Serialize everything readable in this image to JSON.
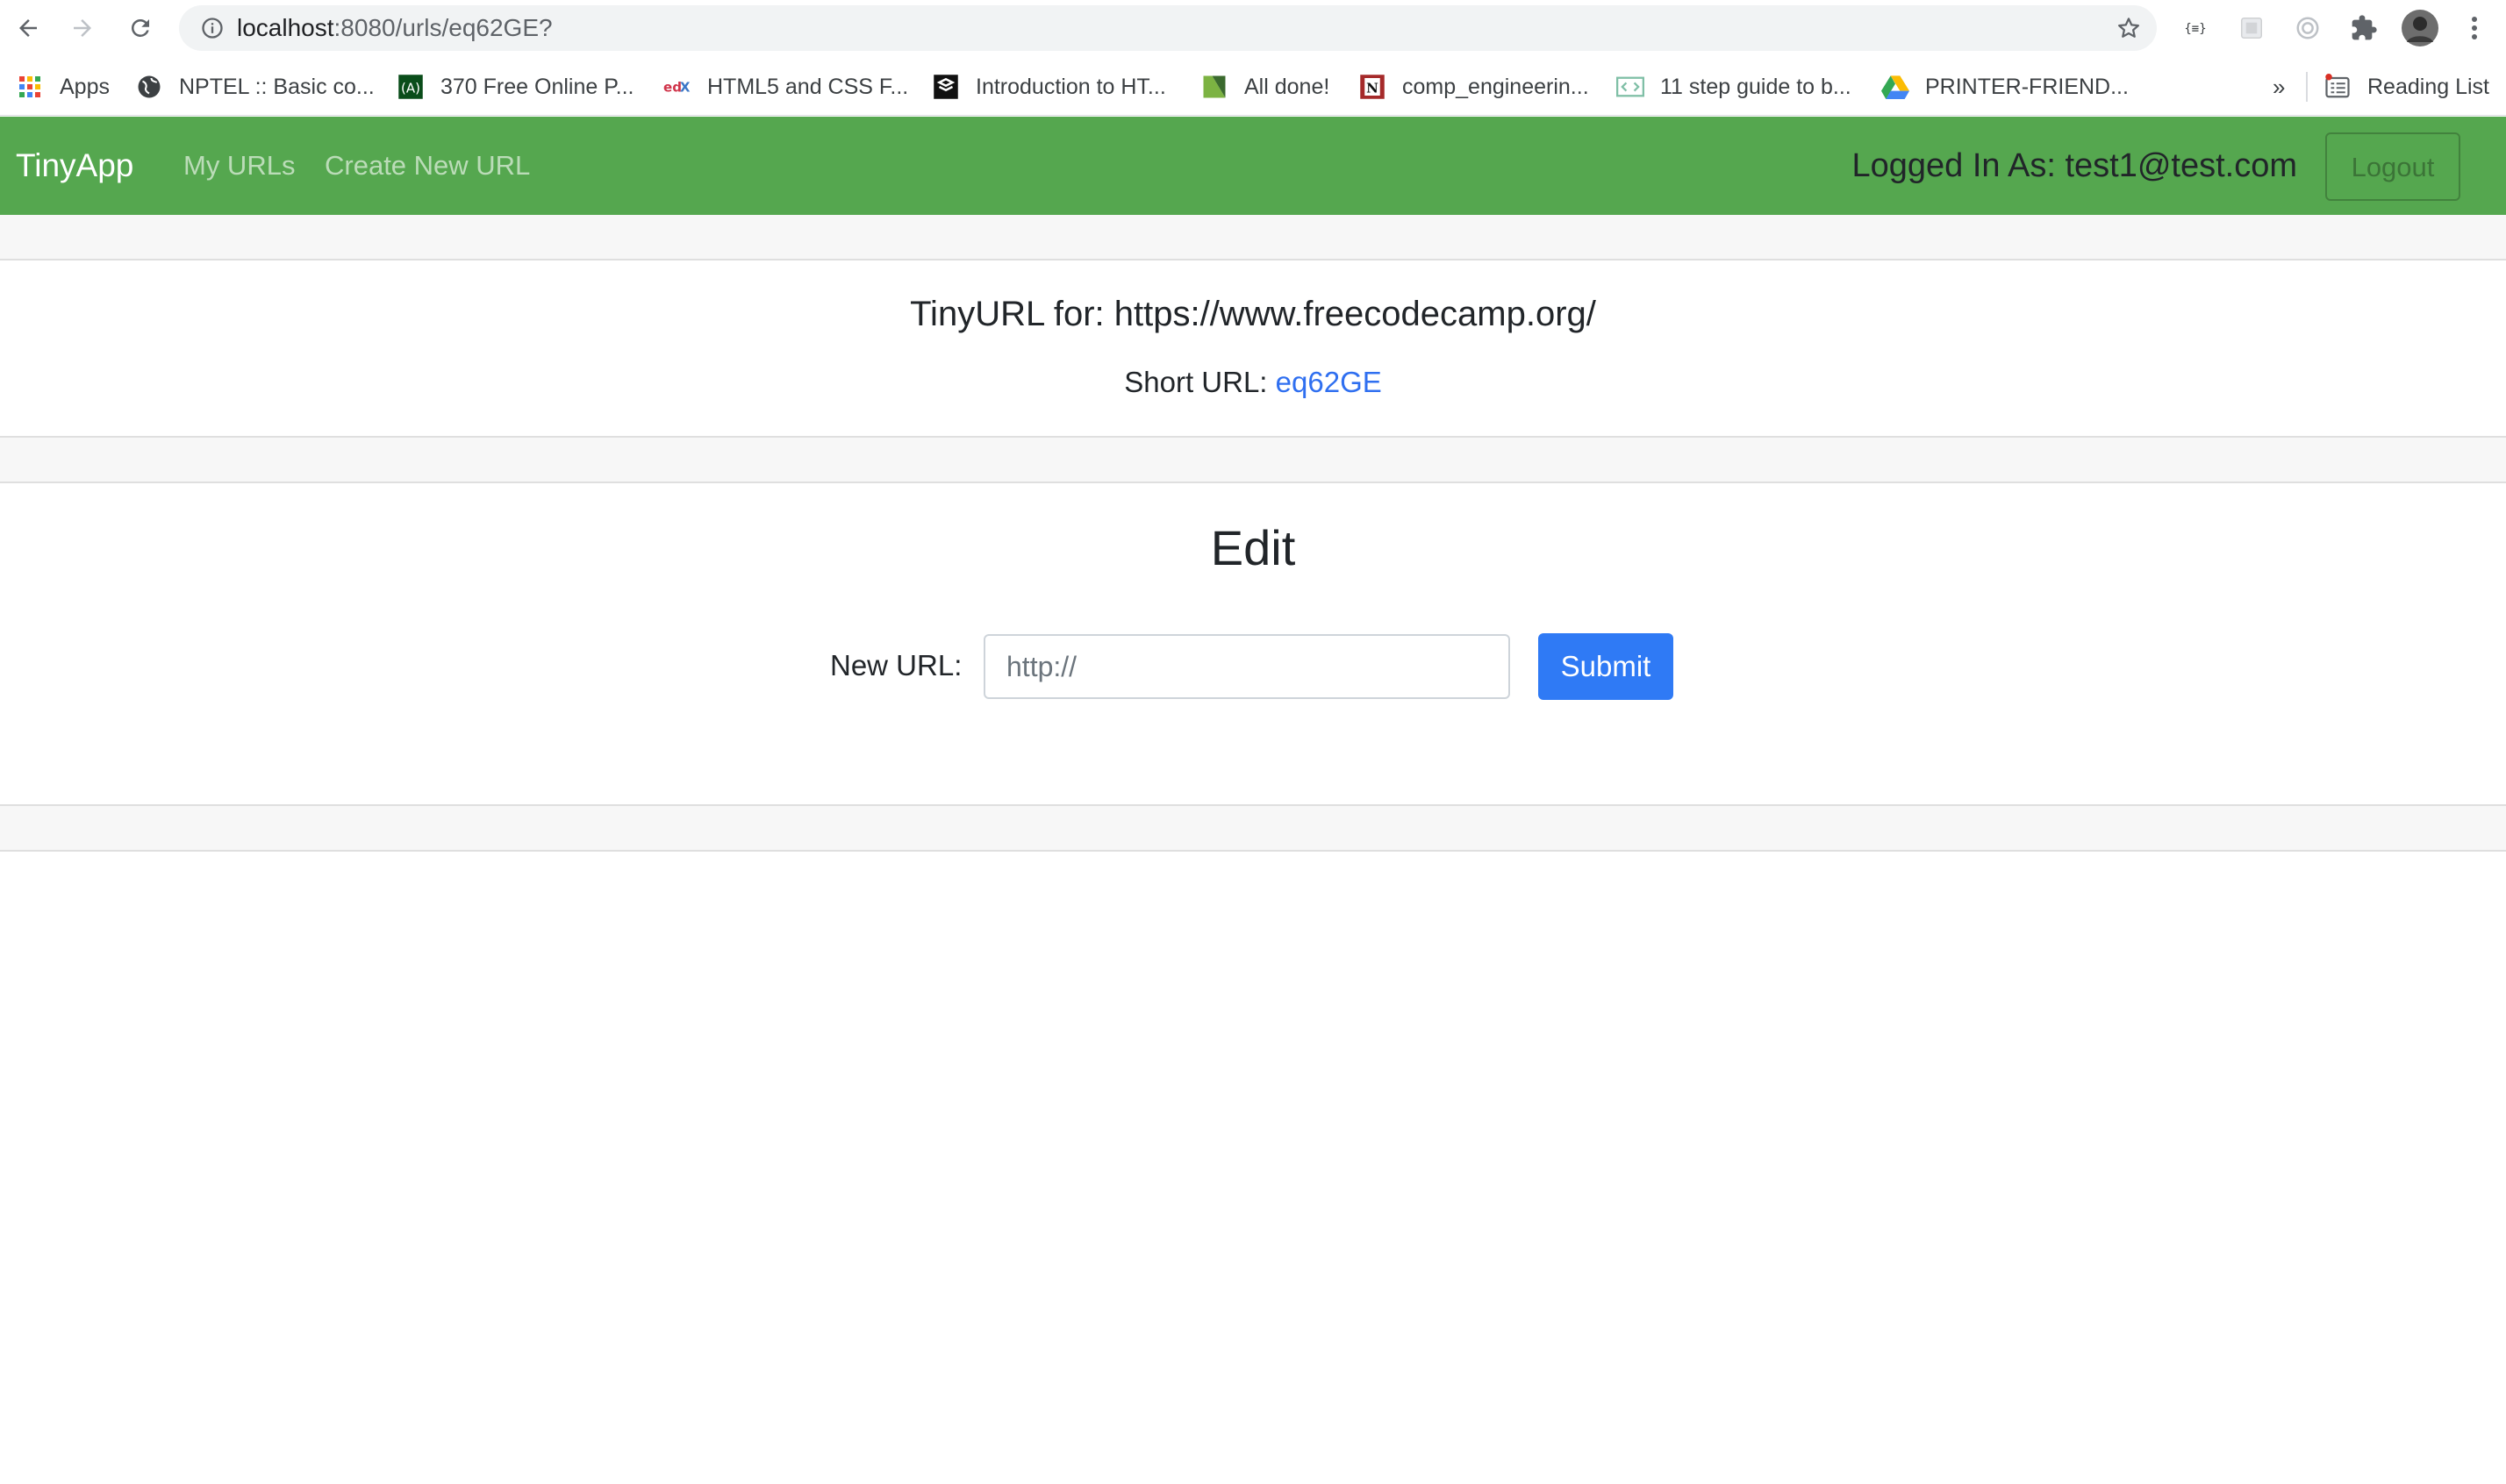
{
  "browser": {
    "url_host": "localhost",
    "url_path": ":8080/urls/eq62GE?",
    "bookmarks": [
      {
        "label": "Apps",
        "icon": "apps-grid-icon"
      },
      {
        "label": "NPTEL :: Basic co...",
        "icon": "globe-icon"
      },
      {
        "label": "370 Free Online P...",
        "icon": "freecodecamp-icon"
      },
      {
        "label": "HTML5 and CSS F...",
        "icon": "edx-icon"
      },
      {
        "label": "Introduction to HT...",
        "icon": "codecademy-icon"
      },
      {
        "label": "All done!",
        "icon": "kodable-icon"
      },
      {
        "label": "comp_engineerin...",
        "icon": "notion-icon"
      },
      {
        "label": "11 step guide to b...",
        "icon": "code-icon"
      },
      {
        "label": "PRINTER-FRIEND...",
        "icon": "google-drive-icon"
      }
    ],
    "overflow": "»",
    "reading_list": "Reading List",
    "colors": {
      "toolbar": "#ffffff",
      "omnibox": "#f1f3f4"
    }
  },
  "navbar": {
    "brand": "TinyApp",
    "links": [
      "My URLs",
      "Create New URL"
    ],
    "logged_in": "Logged In As: test1@test.com",
    "logout": "Logout",
    "color": "#55a74f"
  },
  "url_card": {
    "title": "TinyURL for: https://www.freecodecamp.org/",
    "short_label": "Short URL:",
    "short_value": "eq62GE"
  },
  "edit": {
    "heading": "Edit",
    "label": "New URL:",
    "placeholder": "http://",
    "value": "",
    "submit": "Submit",
    "submit_color": "#2f7af5"
  }
}
